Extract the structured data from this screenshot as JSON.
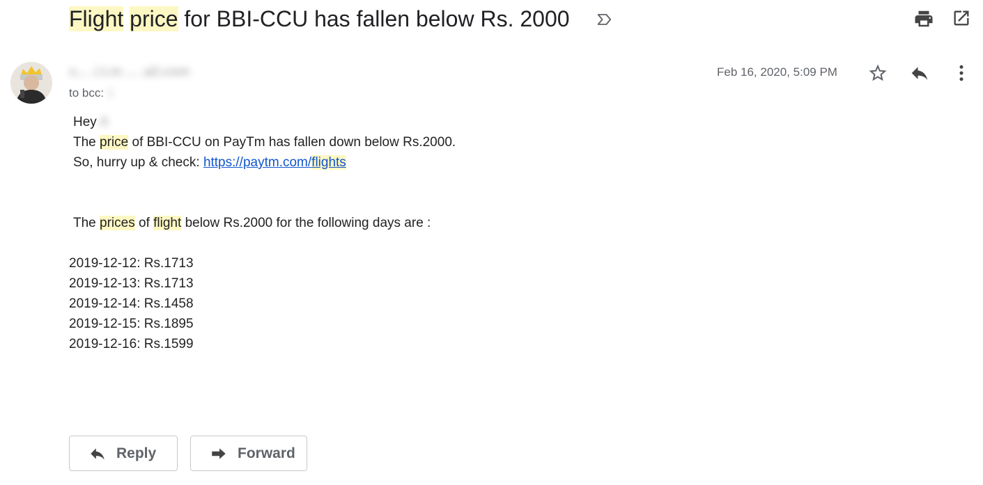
{
  "subject": {
    "word1": "Flight",
    "word2": "price",
    "rest": "for BBI-CCU has fallen below Rs. 2000"
  },
  "icons": {
    "label": "label-arrow-icon",
    "print": "print-icon",
    "open": "open-in-new-window-icon",
    "star": "star-icon",
    "reply": "reply-icon",
    "more": "more-vert-icon",
    "forward": "forward-arrow-icon"
  },
  "message": {
    "sender_redacted": "s... .i.t.m ... .ail.com",
    "to_prefix": "to bcc:",
    "to_redacted": "1",
    "date": "Feb 16, 2020, 5:09 PM"
  },
  "body": {
    "greeting": "Hey",
    "greeting_name_redacted": "A",
    "line1_prefix": "The",
    "line1_hl": "price",
    "line1_suffix": "of BBI-CCU on PayTm has fallen down below Rs.2000.",
    "line2_prefix": "So, hurry up & check:",
    "link_part1": "https://paytm.com/",
    "link_part2": "flights",
    "intro_prefix": "The",
    "intro_hl1": "prices",
    "intro_mid": "of",
    "intro_hl2": "flight",
    "intro_suffix": "below Rs.2000 for the following days are :",
    "prices": [
      "2019-12-12: Rs.1713",
      "2019-12-13: Rs.1713",
      "2019-12-14: Rs.1458",
      "2019-12-15: Rs.1895",
      "2019-12-16: Rs.1599"
    ]
  },
  "actions": {
    "reply_label": "Reply",
    "forward_label": "Forward"
  },
  "colors": {
    "highlight": "#fdf7c3",
    "link": "#1155cc",
    "muted_text": "#5f6368"
  }
}
